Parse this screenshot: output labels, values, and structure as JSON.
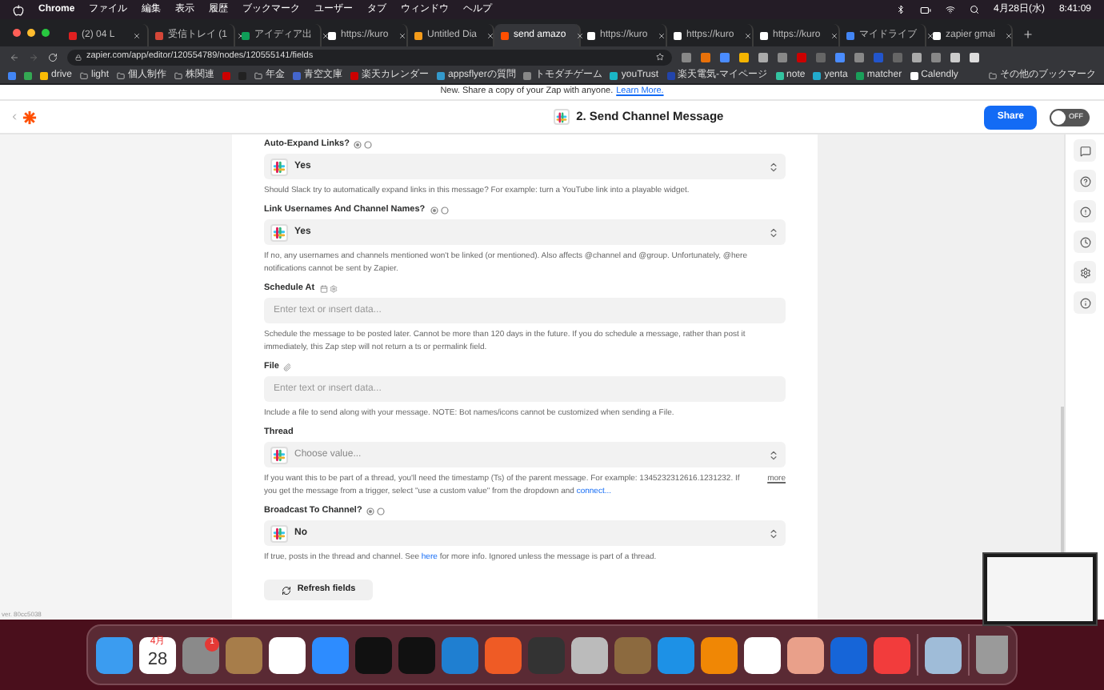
{
  "menu_bar": {
    "app": "Chrome",
    "menus": [
      "ファイル",
      "編集",
      "表示",
      "履歴",
      "ブックマーク",
      "ユーザー",
      "タブ",
      "ウィンドウ",
      "ヘルプ"
    ],
    "date": "4月28日(水)",
    "time": "8:41:09"
  },
  "tabs": [
    {
      "title": "(2) 04 L",
      "selected": false
    },
    {
      "title": "受信トレイ (1",
      "selected": false
    },
    {
      "title": "アイディア出",
      "selected": false
    },
    {
      "title": "https://kuro",
      "selected": false
    },
    {
      "title": "Untitled Dia",
      "selected": false
    },
    {
      "title": "send amazo",
      "selected": true
    },
    {
      "title": "https://kuro",
      "selected": false
    },
    {
      "title": "https://kuro",
      "selected": false
    },
    {
      "title": "https://kuro",
      "selected": false
    },
    {
      "title": "マイドライブ",
      "selected": false
    },
    {
      "title": "zapier gmai",
      "selected": false
    }
  ],
  "address": {
    "url": "zapier.com/app/editor/120554789/nodes/120555141/fields"
  },
  "bookmarks": [
    {
      "kind": "icon"
    },
    {
      "kind": "icon"
    },
    {
      "kind": "site",
      "label": "drive"
    },
    {
      "kind": "folder",
      "label": "light"
    },
    {
      "kind": "folder",
      "label": "個人制作"
    },
    {
      "kind": "folder",
      "label": "株関連"
    },
    {
      "kind": "icon"
    },
    {
      "kind": "icon"
    },
    {
      "kind": "folder",
      "label": "年金"
    },
    {
      "kind": "site",
      "label": "青空文庫"
    },
    {
      "kind": "site",
      "label": "楽天カレンダー"
    },
    {
      "kind": "site",
      "label": "appsflyerの質問"
    },
    {
      "kind": "site",
      "label": "トモダチゲーム"
    },
    {
      "kind": "site",
      "label": "youTrust"
    },
    {
      "kind": "site",
      "label": "楽天電気-マイページ"
    },
    {
      "kind": "site",
      "label": "note"
    },
    {
      "kind": "site",
      "label": "yenta"
    },
    {
      "kind": "site",
      "label": "matcher"
    },
    {
      "kind": "site",
      "label": "Calendly"
    }
  ],
  "other_bookmarks": "その他のブックマーク",
  "banner": {
    "text": "New. Share a copy of your Zap with anyone.",
    "link": "Learn More."
  },
  "header": {
    "step": "2. Send Channel Message",
    "share": "Share",
    "toggle": {
      "label": "OFF",
      "on": false
    }
  },
  "fields": [
    {
      "kind": "select",
      "label": "Auto-Expand Links?",
      "label_icon": {
        "kind": "boolean"
      },
      "value": "Yes",
      "help": "Should Slack try to automatically expand links in this message? For example: turn a YouTube link into a playable widget."
    },
    {
      "kind": "select",
      "label": "Link Usernames And Channel Names?",
      "label_icon": {
        "kind": "boolean"
      },
      "value": "Yes",
      "help": "If no, any usernames and channels mentioned won't be linked (or mentioned). Also affects @channel and @group. Unfortunately, @here notifications cannot be sent by Zapier."
    },
    {
      "kind": "input",
      "label": "Schedule At",
      "label_icon": {
        "kind": "datetime"
      },
      "placeholder": "Enter text or insert data...",
      "help": "Schedule the message to be posted later. Cannot be more than 120 days in the future. If you do schedule a message, rather than post it immediately, this Zap step will not return a ts or permalink field."
    },
    {
      "kind": "input",
      "label": "File",
      "label_icon": {
        "kind": "file"
      },
      "placeholder": "Enter text or insert data...",
      "help": "Include a file to send along with your message. NOTE: Bot names/icons cannot be customized when sending a File."
    },
    {
      "kind": "select",
      "label": "Thread",
      "placeholder": "Choose value...",
      "help": "If you want this to be part of a thread, you'll need the timestamp (Ts) of the parent message. For example: 1345232312616.1231232. If you get the message from a trigger, select \"use a custom value\" from the dropdown and",
      "help_link": "connect...",
      "more": "more"
    },
    {
      "kind": "select",
      "label": "Broadcast To Channel?",
      "label_icon": {
        "kind": "boolean"
      },
      "value": "No",
      "help": "If true, posts in the thread and channel. See",
      "help_link": "here",
      "help_after": "for more info. Ignored unless the message is part of a thread."
    }
  ],
  "refresh": "Refresh fields",
  "version": "ver. 80cc5038",
  "dock": {
    "calendar_month": "4月",
    "calendar_day": "28",
    "settings_badge": "1"
  }
}
